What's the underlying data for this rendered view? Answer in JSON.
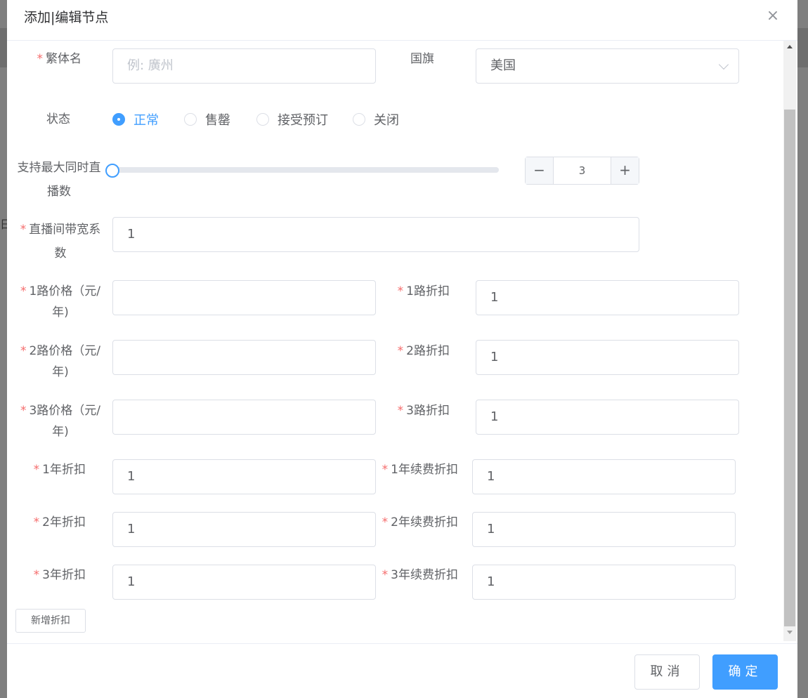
{
  "dialog": {
    "title": "添加|编辑节点",
    "close_glyph": "×"
  },
  "form": {
    "traditional_name": {
      "label": "繁体名",
      "placeholder": "例: 廣州",
      "value": ""
    },
    "flag": {
      "label": "国旗",
      "value": "美国"
    },
    "status": {
      "label": "状态",
      "options": [
        "正常",
        "售罄",
        "接受预订",
        "关闭"
      ],
      "selected": "正常"
    },
    "max_streams": {
      "label_line1": "支持最大同时直",
      "label_line2": "播数",
      "value": "3",
      "slider_fraction": 0
    },
    "bandwidth_coef": {
      "label_line1": "直播间带宽系",
      "label_line2": "数",
      "value": "1"
    },
    "price_rows": [
      {
        "price_label_line1": "1路价格（元/",
        "price_label_line2": "年)",
        "price_value": "",
        "discount_label": "1路折扣",
        "discount_value": "1"
      },
      {
        "price_label_line1": "2路价格（元/",
        "price_label_line2": "年)",
        "price_value": "",
        "discount_label": "2路折扣",
        "discount_value": "1"
      },
      {
        "price_label_line1": "3路价格（元/",
        "price_label_line2": "年)",
        "price_value": "",
        "discount_label": "3路折扣",
        "discount_value": "1"
      }
    ],
    "year_rows": [
      {
        "year_label": "1年折扣",
        "year_value": "1",
        "renew_label": "1年续费折扣",
        "renew_value": "1"
      },
      {
        "year_label": "2年折扣",
        "year_value": "1",
        "renew_label": "2年续费折扣",
        "renew_value": "1"
      },
      {
        "year_label": "3年折扣",
        "year_value": "1",
        "renew_label": "3年续费折扣",
        "renew_value": "1"
      }
    ],
    "add_discount_label": "新增折扣"
  },
  "stepper": {
    "dec_glyph": "−",
    "inc_glyph": "+"
  },
  "footer": {
    "cancel_label": "取消",
    "confirm_label": "确定"
  },
  "background": {
    "glyph": "日"
  },
  "colors": {
    "primary": "#409eff",
    "required": "#f56c6c",
    "border": "#dcdfe6",
    "text": "#606266"
  }
}
